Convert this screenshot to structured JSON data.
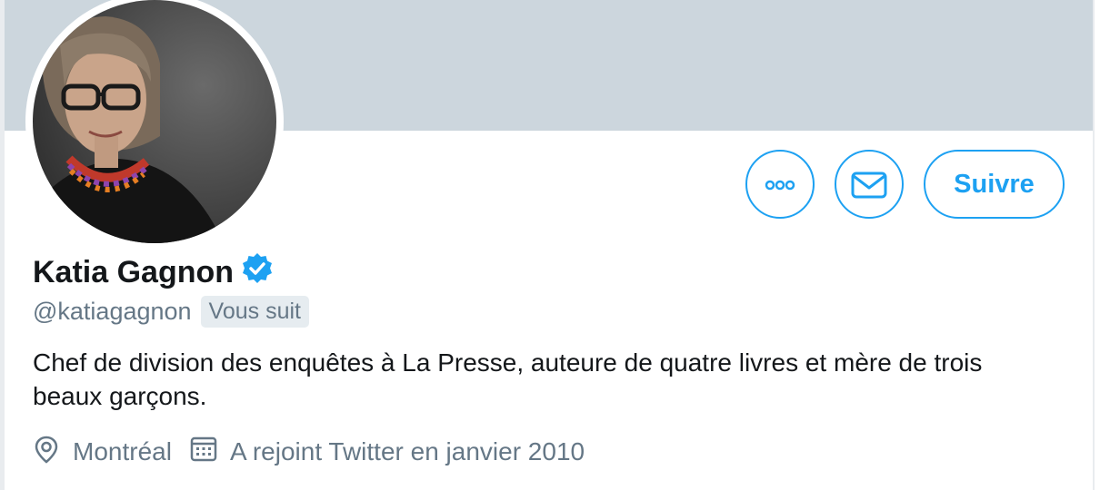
{
  "profile": {
    "display_name": "Katia Gagnon",
    "verified": true,
    "handle": "@katiagagnon",
    "follows_you_label": "Vous suit",
    "bio": "Chef de division des enquêtes à La Presse, auteure de quatre livres et mère de trois beaux garçons.",
    "location": "Montréal",
    "joined": "A rejoint Twitter en janvier 2010"
  },
  "actions": {
    "more_icon": "more-icon",
    "message_icon": "envelope-icon",
    "follow_label": "Suivre"
  },
  "icons": {
    "location": "location-pin-icon",
    "joined": "calendar-icon",
    "verified": "verified-badge-icon"
  },
  "colors": {
    "accent": "#1da1f2",
    "banner": "#ccd6dd",
    "text_primary": "#14171a",
    "text_secondary": "#657786",
    "badge_bg": "#e6ecf0"
  }
}
